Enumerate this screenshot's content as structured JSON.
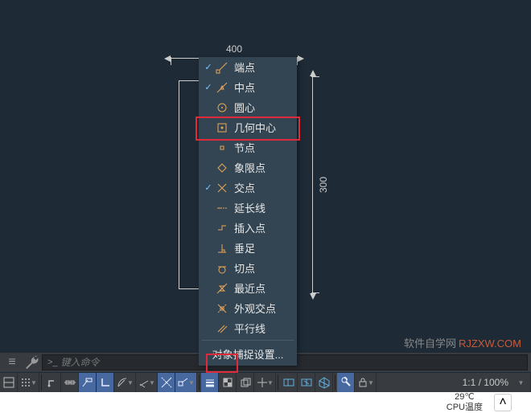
{
  "canvas": {
    "dim_top_value": "400",
    "dim_right_value": "300"
  },
  "snap_menu": {
    "items": [
      {
        "id": "endpoint",
        "label": "端点",
        "checked": true
      },
      {
        "id": "midpoint",
        "label": "中点",
        "checked": true
      },
      {
        "id": "center",
        "label": "圆心",
        "checked": false
      },
      {
        "id": "geocenter",
        "label": "几何中心",
        "checked": false
      },
      {
        "id": "node",
        "label": "节点",
        "checked": false
      },
      {
        "id": "quadrant",
        "label": "象限点",
        "checked": false
      },
      {
        "id": "intersection",
        "label": "交点",
        "checked": true
      },
      {
        "id": "extension",
        "label": "延长线",
        "checked": false
      },
      {
        "id": "insertion",
        "label": "插入点",
        "checked": false
      },
      {
        "id": "perpendicular",
        "label": "垂足",
        "checked": false
      },
      {
        "id": "tangent",
        "label": "切点",
        "checked": false
      },
      {
        "id": "nearest",
        "label": "最近点",
        "checked": false
      },
      {
        "id": "apparent",
        "label": "外观交点",
        "checked": false
      },
      {
        "id": "parallel",
        "label": "平行线",
        "checked": false
      }
    ],
    "settings_label": "对象捕捉设置..."
  },
  "command": {
    "placeholder": "键入命令"
  },
  "status": {
    "zoom": "1:1 / 100%"
  },
  "watermark": {
    "text1": "软件自学网",
    "text2": "RJZXW.COM"
  },
  "system": {
    "temp": "29℃",
    "cpu": "CPU温度"
  }
}
